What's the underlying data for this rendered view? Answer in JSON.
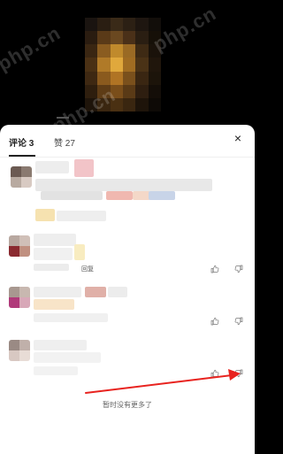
{
  "video": {
    "watermarks": [
      "php.cn",
      "php.cn",
      "php.cn"
    ]
  },
  "tabs": {
    "comments_label": "评论 3",
    "likes_label": "赞 27"
  },
  "close_label": "×",
  "comments": [
    {
      "reply_label": "",
      "has_like": false
    },
    {
      "reply_label": "回复",
      "has_like": true
    },
    {
      "reply_label": "",
      "has_like": true
    },
    {
      "reply_label": "",
      "has_like": true
    }
  ],
  "footer": {
    "end_text": "暂时没有更多了"
  },
  "colors": {
    "arrow": "#e8231f",
    "sheet_bg": "#ffffff",
    "backdrop": "#000000"
  },
  "icons": {
    "like": "thumbs-up-icon",
    "dislike": "thumbs-down-icon",
    "close": "close-icon"
  }
}
